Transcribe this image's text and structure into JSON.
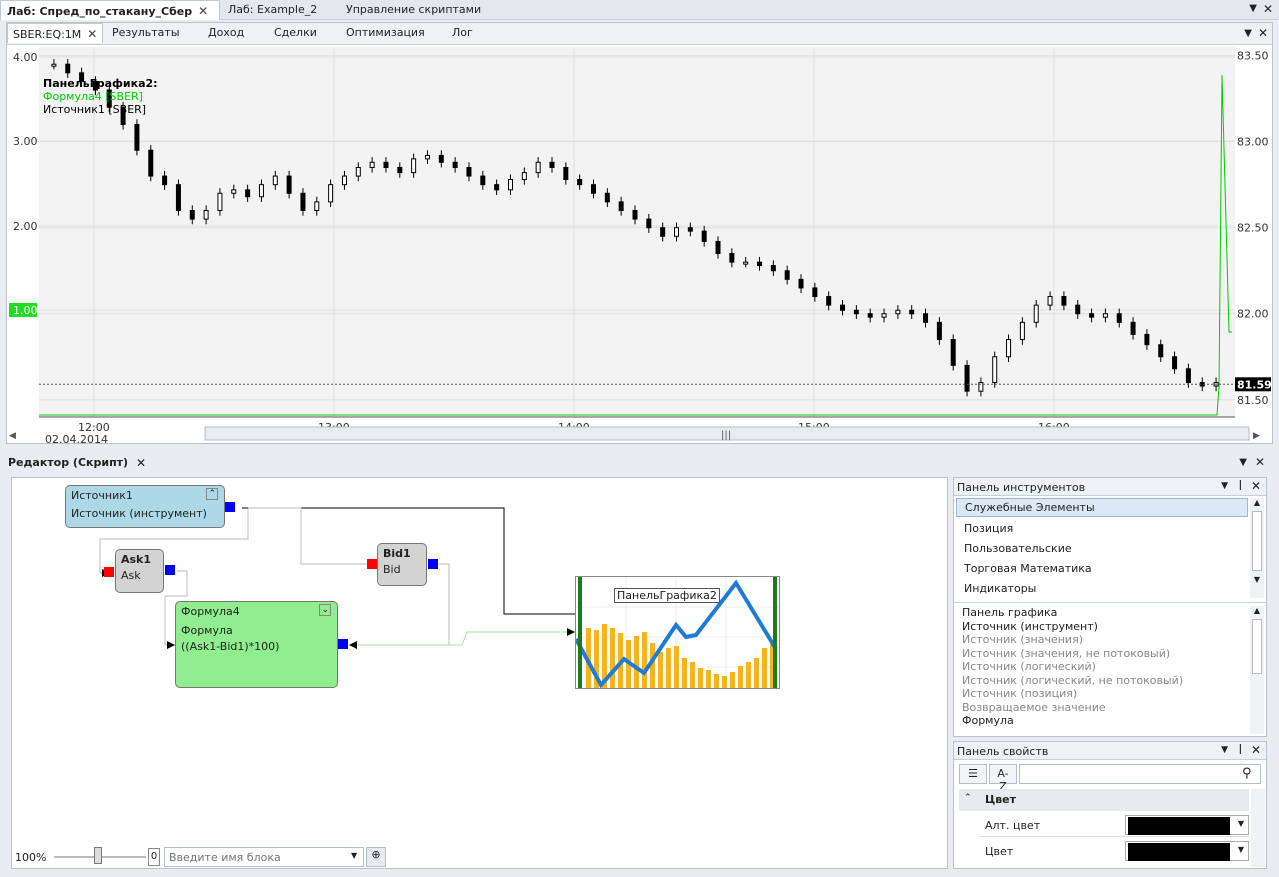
{
  "doc_tabs": [
    {
      "label": "Лаб: Спред_по_стакану_Сбер"
    },
    {
      "label": "Лаб: Example_2"
    },
    {
      "label": "Управление скриптами"
    }
  ],
  "sub_tabs": [
    "SBER:EQ:1M",
    "Результаты",
    "Доход",
    "Сделки",
    "Оптимизация",
    "Лог"
  ],
  "chart_data": {
    "type": "line",
    "title": "ПанельГрафика2:",
    "series": [
      {
        "name": "Формула4 [SBER]",
        "color": "#00cc00"
      },
      {
        "name": "Источник1 [SBER]",
        "color": "#000000"
      }
    ],
    "left_axis": {
      "ticks": [
        "4.00",
        "3.00",
        "2.00",
        "1.00"
      ],
      "highlight": "1.00"
    },
    "right_axis": {
      "ticks": [
        "83.50",
        "83.00",
        "82.50",
        "82.00",
        "81.50"
      ],
      "last_price": "81.59"
    },
    "x_ticks": [
      "12:00",
      "13:00",
      "14:00",
      "15:00",
      "16:00"
    ],
    "date_label": "02.04.2014",
    "ylim": [
      81.4,
      83.55
    ],
    "price": [
      83.45,
      83.4,
      83.35,
      83.3,
      83.2,
      83.1,
      82.95,
      82.8,
      82.75,
      82.6,
      82.55,
      82.6,
      82.7,
      82.72,
      82.68,
      82.75,
      82.8,
      82.7,
      82.6,
      82.65,
      82.75,
      82.8,
      82.85,
      82.88,
      82.85,
      82.82,
      82.9,
      82.92,
      82.88,
      82.85,
      82.8,
      82.75,
      82.72,
      82.78,
      82.82,
      82.88,
      82.85,
      82.78,
      82.75,
      82.7,
      82.65,
      82.6,
      82.55,
      82.5,
      82.45,
      82.5,
      82.48,
      82.42,
      82.35,
      82.3,
      82.3,
      82.28,
      82.25,
      82.2,
      82.15,
      82.1,
      82.05,
      82.02,
      82.0,
      81.98,
      82.0,
      82.02,
      82.0,
      81.95,
      81.85,
      81.7,
      81.55,
      81.6,
      81.75,
      81.85,
      81.95,
      82.05,
      82.1,
      82.05,
      82.0,
      81.98,
      82.0,
      81.95,
      81.88,
      81.82,
      81.75,
      81.68,
      81.6,
      81.58,
      81.6
    ]
  },
  "editor": {
    "title": "Редактор (Скрипт)",
    "nodes": {
      "src": {
        "name": "Источник1",
        "sub": "Источник (инструмент)"
      },
      "ask": {
        "name": "Ask1",
        "sub": "Ask"
      },
      "bid": {
        "name": "Bid1",
        "sub": "Bid"
      },
      "formula": {
        "name": "Формула4",
        "sub": "Формула",
        "expr": "((Ask1-Bid1)*100)"
      },
      "panel": {
        "name": "ПанельГрафика2"
      }
    },
    "zoom": "100%",
    "zoom_value": "0",
    "search_placeholder": "Введите имя блока"
  },
  "toolbox": {
    "title": "Панель инструментов",
    "categories": [
      "Служебные Элементы",
      "Позиция",
      "Пользовательские",
      "Торговая Математика",
      "Индикаторы"
    ],
    "items": [
      {
        "label": "Панель графика",
        "enabled": true
      },
      {
        "label": "Источник (инструмент)",
        "enabled": true
      },
      {
        "label": "Источник (значения)",
        "enabled": false
      },
      {
        "label": "Источник (значения, не потоковый)",
        "enabled": false
      },
      {
        "label": "Источник (логический)",
        "enabled": false
      },
      {
        "label": "Источник (логический, не потоковый)",
        "enabled": false
      },
      {
        "label": "Источник (позиция)",
        "enabled": false
      },
      {
        "label": "Возвращаемое значение",
        "enabled": false
      },
      {
        "label": "Формула",
        "enabled": true
      }
    ]
  },
  "props": {
    "title": "Панель свойств",
    "az": "A-Z",
    "section": "Цвет",
    "rows": [
      {
        "label": "Алт. цвет",
        "value": "#000000"
      },
      {
        "label": "Цвет",
        "value": "#000000"
      }
    ]
  }
}
